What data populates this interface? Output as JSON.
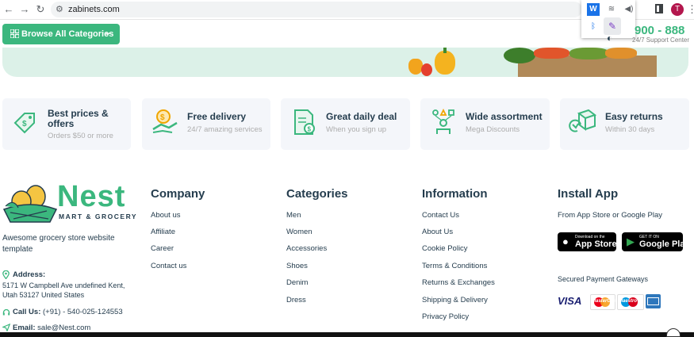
{
  "browser": {
    "url": "zabinets.com",
    "avatar_letter": "T",
    "extensions": [
      "word-icon",
      "bluetooth-icon",
      "wifi-icon",
      "volume-icon",
      "pen-icon"
    ]
  },
  "header": {
    "browse_label": "Browse  All Categories",
    "support_number": "900 - 888",
    "support_text": "24/7 Support Center"
  },
  "features": [
    {
      "title": "Best prices & offers",
      "subtitle": "Orders $50 or more"
    },
    {
      "title": "Free delivery",
      "subtitle": "24/7 amazing services"
    },
    {
      "title": "Great daily deal",
      "subtitle": "When you sign up"
    },
    {
      "title": "Wide assortment",
      "subtitle": "Mega Discounts"
    },
    {
      "title": "Easy returns",
      "subtitle": "Within 30 days"
    }
  ],
  "brand": {
    "name": "Nest",
    "subtitle": "MART & GROCERY",
    "tagline": "Awesome grocery store website template",
    "address_label": "Address:",
    "address": "5171 W Campbell Ave undefined Kent, Utah 53127 United States",
    "call_label": "Call Us:",
    "call_value": "(+91) - 540-025-124553",
    "email_label": "Email:",
    "email_value": "sale@Nest.com"
  },
  "columns": [
    {
      "heading": "Company",
      "links": [
        "About us",
        "Affiliate",
        "Career",
        "Contact us"
      ]
    },
    {
      "heading": "Categories",
      "links": [
        "Men",
        "Women",
        "Accessories",
        "Shoes",
        "Denim",
        "Dress"
      ]
    },
    {
      "heading": "Information",
      "links": [
        "Contact Us",
        "About Us",
        "Cookie Policy",
        "Terms & Conditions",
        "Returns & Exchanges",
        "Shipping & Delivery",
        "Privacy Policy"
      ]
    }
  ],
  "install": {
    "heading": "Install App",
    "note": "From App Store or Google Play",
    "appstore_small": "Download on the",
    "appstore_large": "App Store",
    "play_small": "GET IT ON",
    "play_large": "Google Play",
    "secure_label": "Secured Payment Gateways",
    "visa": "VISA",
    "mastercard": "MasterCard",
    "maestro": "Maestro"
  },
  "colors": {
    "brand_green": "#3bb77e",
    "text_dark": "#253d4e",
    "muted": "#adadad"
  }
}
